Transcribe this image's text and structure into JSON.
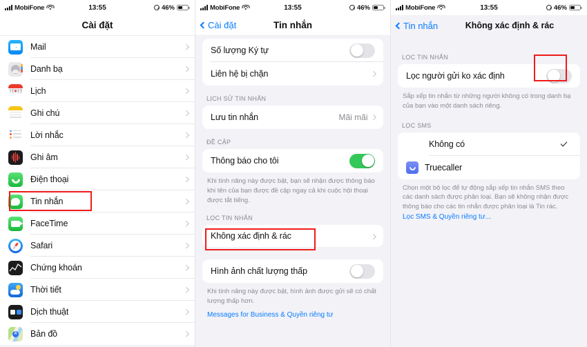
{
  "status_bar": {
    "carrier": "MobiFone",
    "time": "13:55",
    "battery_percent": "46%"
  },
  "panel1": {
    "nav_title": "Cài đặt",
    "items": [
      {
        "label": "Mail",
        "icon": "mail-icon"
      },
      {
        "label": "Danh bạ",
        "icon": "contacts-icon"
      },
      {
        "label": "Lịch",
        "icon": "calendar-icon"
      },
      {
        "label": "Ghi chú",
        "icon": "notes-icon"
      },
      {
        "label": "Lời nhắc",
        "icon": "reminders-icon"
      },
      {
        "label": "Ghi âm",
        "icon": "voice-memos-icon"
      },
      {
        "label": "Điện thoại",
        "icon": "phone-icon"
      },
      {
        "label": "Tin nhắn",
        "icon": "messages-icon"
      },
      {
        "label": "FaceTime",
        "icon": "facetime-icon"
      },
      {
        "label": "Safari",
        "icon": "safari-icon"
      },
      {
        "label": "Chứng khoán",
        "icon": "stocks-icon"
      },
      {
        "label": "Thời tiết",
        "icon": "weather-icon"
      },
      {
        "label": "Dịch thuật",
        "icon": "translate-icon"
      },
      {
        "label": "Bản đồ",
        "icon": "maps-icon"
      }
    ]
  },
  "panel2": {
    "back_label": "Cài đặt",
    "nav_title": "Tin nhắn",
    "row_char_count": "Số lượng Ký tự",
    "row_blocked": "Liên hệ bị chặn",
    "section_history": "LỊCH SỬ TIN NHẮN",
    "row_keep": "Lưu tin nhắn",
    "row_keep_value": "Mãi mãi",
    "section_mentions": "ĐỀ CẬP",
    "row_notify_me": "Thông báo cho tôi",
    "mentions_footnote": "Khi tính năng này được bật, bạn sẽ nhận được thông báo khi tên của bạn được đề cập ngay cả khi cuộc hội thoại được tắt tiếng.",
    "section_filter": "LỌC TIN NHẮN",
    "row_unknown_junk": "Không xác định & rác",
    "row_low_quality": "Hình ảnh chất lượng thấp",
    "low_quality_footnote": "Khi tính năng này được bật, hình ảnh được gửi sẽ có chất lượng thấp hơn.",
    "business_link": "Messages for Business & Quyền riêng tư"
  },
  "panel3": {
    "back_label": "Tin nhắn",
    "nav_title": "Không xác định & rác",
    "section_filter": "LỌC TIN NHẮN",
    "row_filter_unknown": "Lọc người gửi ko xác định",
    "filter_footnote": "Sắp xếp tin nhắn từ những người không có trong danh bạ của bạn vào một danh sách riêng.",
    "section_sms": "LỌC SMS",
    "option_none": "Không có",
    "option_truecaller": "Truecaller",
    "sms_footnote": "Chọn một bộ lọc để tự động sắp xếp tin nhắn SMS theo các danh sách được phân loại. Bạn sẽ không nhận được thông báo cho các tin nhắn được phân loại là Tin rác.",
    "sms_link": "Lọc SMS & Quyền riêng tư..."
  },
  "colors": {
    "accent": "#0a7cff",
    "toggle_on": "#34c759",
    "highlight": "#f01a1a"
  }
}
